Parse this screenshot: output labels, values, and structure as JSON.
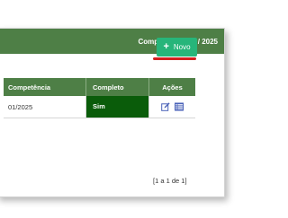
{
  "header": {
    "competencia_label": "Competência: 03 / 2025"
  },
  "toolbar": {
    "novo_icon": "+",
    "novo_label": "Novo"
  },
  "table": {
    "columns": [
      "Competência",
      "Completo",
      "Ações"
    ],
    "rows": [
      {
        "competencia": "01/2025",
        "completo": "Sim",
        "actions": [
          "edit-icon",
          "list-icon"
        ]
      }
    ]
  },
  "pagination": {
    "text": "[1 a 1 de 1]"
  },
  "colors": {
    "header_green": "#4e7f46",
    "button_green": "#27b57a",
    "completo_green": "#0a5c0a",
    "underline_red": "#d42020",
    "icon_blue": "#4a62b8"
  }
}
